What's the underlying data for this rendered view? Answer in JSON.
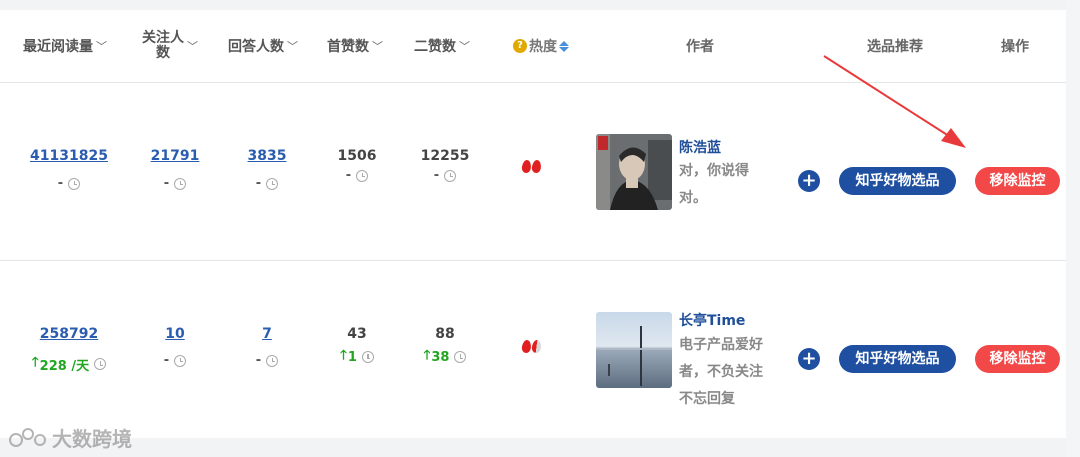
{
  "columns": {
    "read": "最近阅读量",
    "followers_line1": "关注人",
    "followers_line2": "数",
    "answerers": "回答人数",
    "first_likes": "首赞数",
    "second_likes": "二赞数",
    "heat": "热度",
    "author": "作者",
    "recommend": "选品推荐",
    "action": "操作"
  },
  "rows": [
    {
      "read": "41131825",
      "read_sub": "-",
      "followers": "21791",
      "followers_sub": "-",
      "answerers": "3835",
      "answerers_sub": "-",
      "first_likes": "1506",
      "first_likes_sub": "-",
      "second_likes": "12255",
      "second_likes_sub": "-",
      "heat_level": "2 of 2 flames",
      "author_name": "陈浩蓝",
      "author_desc": "对，你说得对。",
      "recommend_label": "知乎好物选品",
      "remove_label": "移除监控"
    },
    {
      "read": "258792",
      "read_sub": "228 /天",
      "followers": "10",
      "followers_sub": "-",
      "answerers": "7",
      "answerers_sub": "-",
      "first_likes": "43",
      "first_likes_sub": "1",
      "second_likes": "88",
      "second_likes_sub": "38",
      "heat_level": "1.5 of 2 flames",
      "author_name": "长亭Time",
      "author_desc": "电子产品爱好者，不负关注不忘回复",
      "recommend_label": "知乎好物选品",
      "remove_label": "移除监控"
    }
  ],
  "watermark": "大数跨境",
  "colors": {
    "link": "#2a5db0",
    "primary_button": "#1e4fa0",
    "danger_button": "#f24848",
    "up_green": "#22a622",
    "arrow_red": "#e83a3a"
  },
  "icons": [
    "chevron-down-icon",
    "clock-icon",
    "help-icon",
    "sort-icon",
    "flame-icon",
    "plus-icon",
    "arrow-up-icon"
  ]
}
